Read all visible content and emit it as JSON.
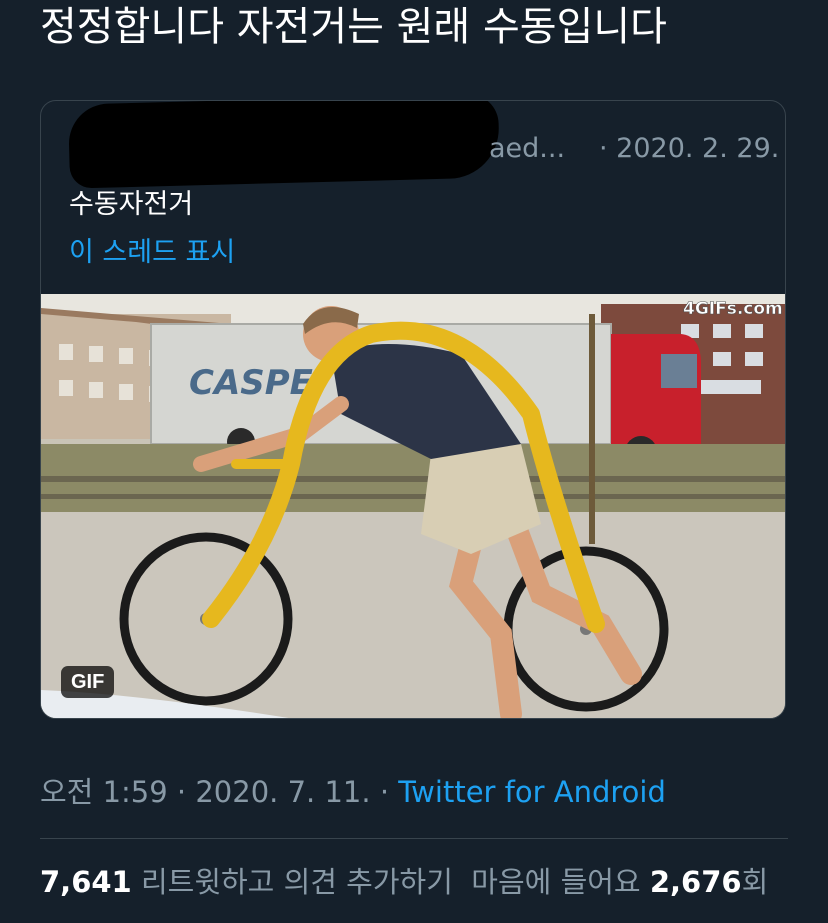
{
  "tweet": {
    "text": "정정합니다 자전거는 원래 수동입니다"
  },
  "quote": {
    "handle_tail": "aed...",
    "date_sep": " · ",
    "date": "2020. 2. 29.",
    "text": "수동자전거",
    "show_thread": "이 스레드 표시",
    "media_badge": "GIF",
    "watermark": "4GIFs.com",
    "truck_text": "CASPE"
  },
  "meta": {
    "time": "오전 1:59",
    "sep1": " · ",
    "date": "2020. 7. 11.",
    "sep2": " · ",
    "source": "Twitter for Android"
  },
  "stats": {
    "retweets_count": "7,641",
    "retweets_label": " 리트윗하고 의견 추가하기",
    "likes_label": "  마음에 들어요 ",
    "likes_count": "2,676",
    "likes_suffix": "회"
  },
  "colors": {
    "background": "#15202b",
    "link": "#1da1f2",
    "muted": "#8899a6",
    "border": "#38444d"
  }
}
